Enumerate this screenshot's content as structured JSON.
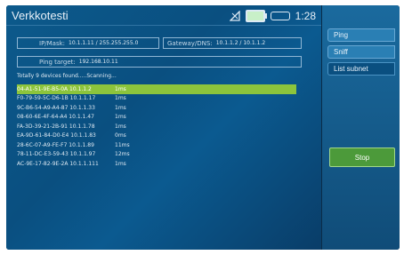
{
  "header": {
    "title": "Verkkotesti",
    "time": "1:28",
    "icons": [
      "signal-icon",
      "battery-icon",
      "battery-outline-icon"
    ]
  },
  "info": {
    "ipmask_label": "IP/Mask:",
    "ipmask_value": "10.1.1.11 / 255.255.255.0",
    "gateway_label": "Gateway/DNS:",
    "gateway_value": "10.1.1.2 / 10.1.1.2",
    "ping_label": "Ping target:",
    "ping_value": "192.168.10.11"
  },
  "scan_status": "Totally 9 devices found.....Scanning...",
  "devices": [
    {
      "device": "04-A1-51-9E-B5-0A 10.1.1.2",
      "time": "1ms"
    },
    {
      "device": "F0-79-59-5C-D6-1B 10.1.1.17",
      "time": "1ms"
    },
    {
      "device": "9C-B6-54-A9-A4-87 10.1.1.33",
      "time": "1ms"
    },
    {
      "device": "08-60-6E-4F-64-A4 10.1.1.47",
      "time": "1ms"
    },
    {
      "device": "FA-3D-39-21-2B-91 10.1.1.78",
      "time": "1ms"
    },
    {
      "device": "EA-9D-61-84-D0-E4 10.1.1.83",
      "time": "0ms"
    },
    {
      "device": "28-6C-07-A9-FE-F7 10.1.1.89",
      "time": "11ms"
    },
    {
      "device": "78-11-DC-E3-59-43 10.1.1.97",
      "time": "12ms"
    },
    {
      "device": "AC-9E-17-82-9E-2A 10.1.1.111",
      "time": "1ms"
    }
  ],
  "sidebar": {
    "tabs": [
      "Ping",
      "Sniff",
      "List subnet"
    ],
    "active_tab": "List subnet",
    "stop_label": "Stop"
  },
  "colors": {
    "selected_row": "#8cc43c",
    "stop_button": "#4c9a3a",
    "background": "#0a4f80"
  }
}
